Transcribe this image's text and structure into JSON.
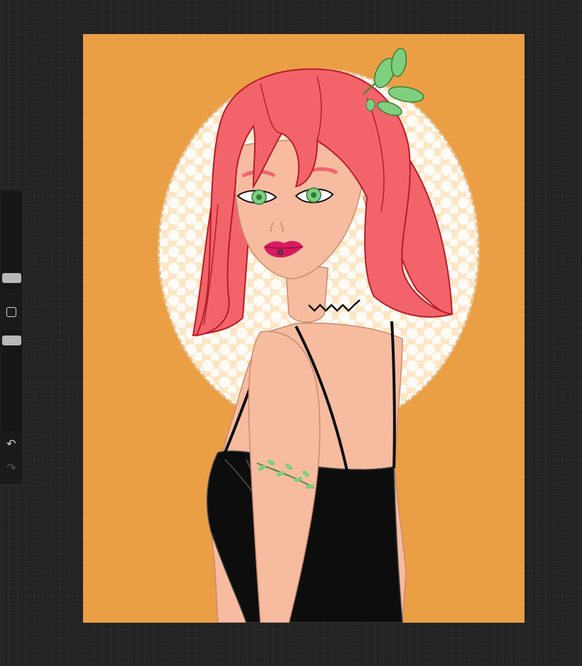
{
  "app": {
    "background": "#232323"
  },
  "canvas": {
    "background_color": "#eb9f45",
    "artwork": "illustration-of-pink-haired-girl-in-black-dress"
  },
  "sidebar": {
    "brush_size_slider": {
      "level": 0.55
    },
    "opacity_slider": {
      "level": 0.95
    },
    "modify_button": {
      "icon": "square-icon"
    },
    "undo_button": {
      "icon": "undo-icon",
      "glyph": "↶"
    },
    "redo_button": {
      "icon": "redo-icon",
      "glyph": "↷",
      "enabled": false
    }
  },
  "colors": {
    "hair": "#f2646a",
    "skin": "#f7bca0",
    "dress": "#0d0d0d",
    "leaf": "#7ecf7e",
    "halo": "#fde6c4",
    "dots": "#ffffff"
  }
}
